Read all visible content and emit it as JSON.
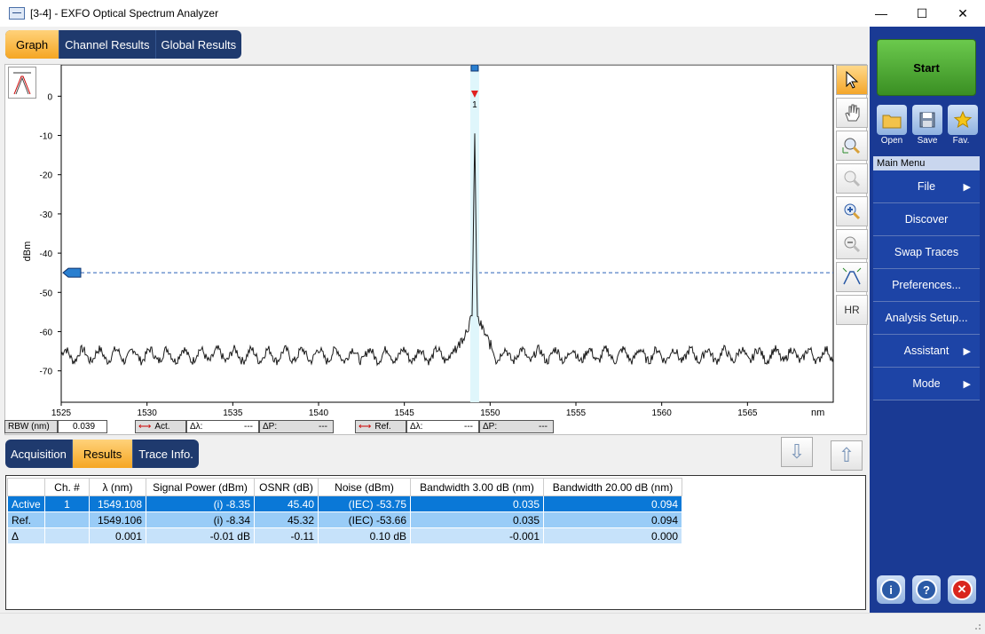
{
  "window": {
    "title": "[3-4] - EXFO Optical Spectrum Analyzer",
    "minimize": "—",
    "maximize": "☐",
    "close": "✕"
  },
  "top_tabs": [
    "Graph",
    "Channel Results",
    "Global Results"
  ],
  "graph": {
    "ylabel": "dBm",
    "xunit": "nm",
    "hr_label": "HR",
    "marker_label": "1"
  },
  "rbw": {
    "label": "RBW (nm)",
    "value": "0.039"
  },
  "act_bar": {
    "label": "Act.",
    "dl": "Δλ:",
    "dl_val": "---",
    "dp": "ΔP:",
    "dp_val": "---"
  },
  "ref_bar": {
    "label": "Ref.",
    "dl": "Δλ:",
    "dl_val": "---",
    "dp": "ΔP:",
    "dp_val": "---"
  },
  "bottom_tabs": [
    "Acquisition",
    "Results",
    "Trace Info."
  ],
  "results": {
    "headers": [
      "",
      "Ch. #",
      "λ (nm)",
      "Signal Power (dBm)",
      "OSNR (dB)",
      "Noise (dBm)",
      "Bandwidth 3.00 dB (nm)",
      "Bandwidth 20.00 dB (nm)"
    ],
    "rows": [
      [
        "Active",
        "1",
        "1549.108",
        "(i) -8.35",
        "45.40",
        "(IEC) -53.75",
        "0.035",
        "0.094"
      ],
      [
        "Ref.",
        "",
        "1549.106",
        "(i) -8.34",
        "45.32",
        "(IEC) -53.66",
        "0.035",
        "0.094"
      ],
      [
        "Δ",
        "",
        "0.001",
        "-0.01 dB",
        "-0.11",
        "0.10 dB",
        "-0.001",
        "0.000"
      ]
    ]
  },
  "right_panel": {
    "start": "Start",
    "files": [
      "Open",
      "Save",
      "Fav."
    ],
    "main_menu_title": "Main Menu",
    "menu": [
      {
        "label": "File",
        "arrow": true
      },
      {
        "label": "Discover",
        "arrow": false
      },
      {
        "label": "Swap Traces",
        "arrow": false
      },
      {
        "label": "Preferences...",
        "arrow": false
      },
      {
        "label": "Analysis Setup...",
        "arrow": false
      },
      {
        "label": "Assistant",
        "arrow": true
      },
      {
        "label": "Mode",
        "arrow": true
      }
    ]
  },
  "chart_data": {
    "type": "line",
    "xlabel": "nm",
    "ylabel": "dBm",
    "xlim": [
      1525,
      1570
    ],
    "ylim": [
      -78,
      8
    ],
    "xticks": [
      1525,
      1530,
      1535,
      1540,
      1545,
      1550,
      1555,
      1560,
      1565
    ],
    "yticks": [
      0,
      -10,
      -20,
      -30,
      -40,
      -50,
      -60,
      -70
    ],
    "threshold": -45,
    "series": [
      {
        "noise_floor": -66,
        "noise_ripple": 1.5,
        "peak_x": 1549.1,
        "peak_y": -8.35
      }
    ]
  }
}
